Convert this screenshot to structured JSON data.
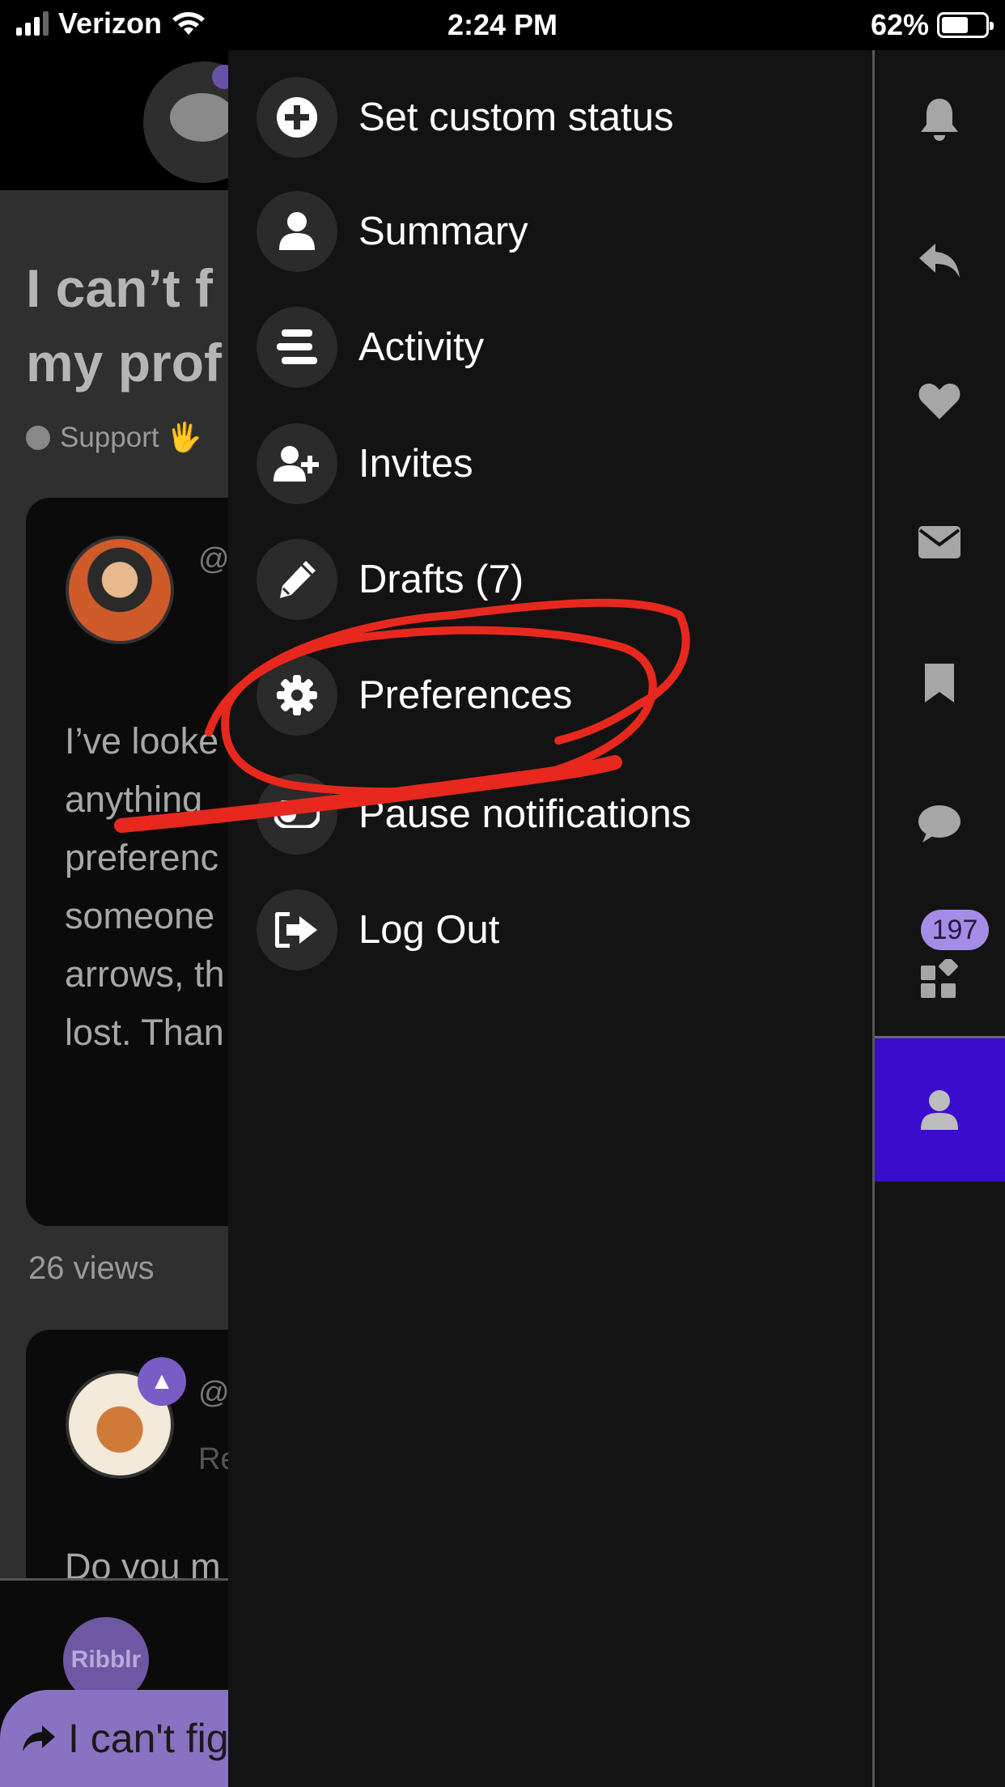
{
  "status_bar": {
    "carrier": "Verizon",
    "time": "2:24 PM",
    "battery_percent": "62%",
    "battery_level": 0.62
  },
  "background_page": {
    "title_line1": "I can’t f",
    "title_line2": "my prof",
    "category": "Support 🖐",
    "post_handle": "@",
    "post_body_lines": [
      "I’ve looke",
      "anything",
      "preferenc",
      "someone",
      "arrows, th",
      "lost. Than"
    ],
    "views": "26 views",
    "reply_handle": "@",
    "reply_meta": "Re",
    "reply_body": "Do you m",
    "footer_avatar_label": "Ribblr",
    "share_label": "I can't fig"
  },
  "menu": {
    "items": [
      {
        "label": "Set custom status",
        "icon": "plus-circle-icon"
      },
      {
        "label": "Summary",
        "icon": "user-icon"
      },
      {
        "label": "Activity",
        "icon": "stream-icon"
      },
      {
        "label": "Invites",
        "icon": "user-plus-icon"
      },
      {
        "label": "Drafts (7)",
        "icon": "pencil-icon"
      },
      {
        "label": "Preferences",
        "icon": "gear-icon"
      },
      {
        "label": "Pause notifications",
        "icon": "toggle-off-icon"
      },
      {
        "label": "Log Out",
        "icon": "sign-out-icon"
      }
    ]
  },
  "rail": {
    "items": [
      "bell-icon",
      "reply-icon",
      "heart-icon",
      "envelope-icon",
      "bookmark-icon",
      "chat-bubble-icon",
      "grid-icon",
      "user-icon"
    ],
    "badge_count": "197",
    "active_color": "#3a0ccc"
  },
  "annotation": {
    "color": "#e8281e"
  }
}
